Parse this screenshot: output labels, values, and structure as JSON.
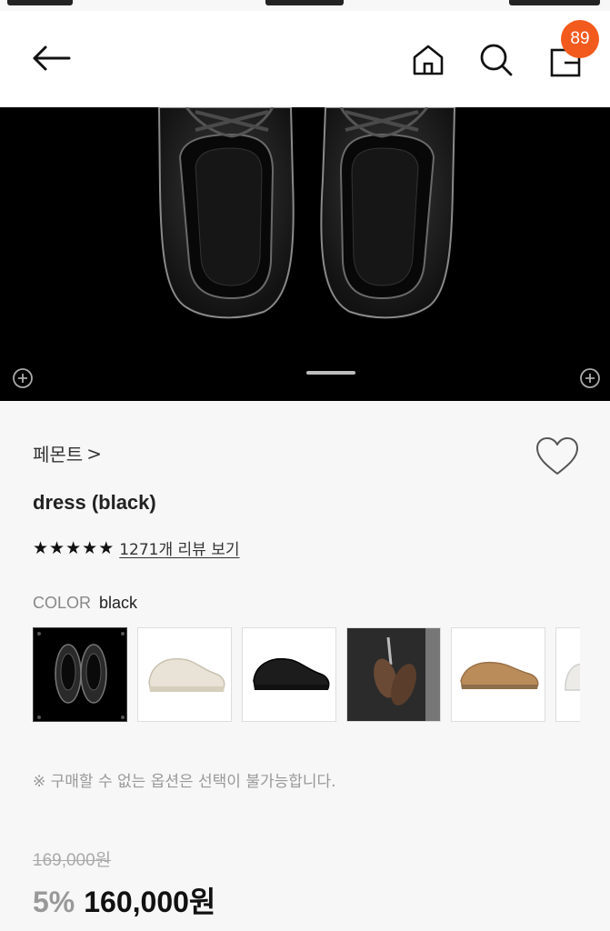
{
  "header": {
    "cart_count": "89"
  },
  "product": {
    "brand": "페몬트",
    "brand_chevron": ">",
    "name": "dress (black)",
    "rating_stars": 5,
    "review_link": "1271개 리뷰 보기",
    "color_label": "COLOR",
    "color_value": "black",
    "option_notice": "※ 구매할 수 없는 옵션은 선택이 불가능합니다.",
    "original_price": "169,000원",
    "discount": "5%",
    "sale_price": "160,000원"
  },
  "color_options": [
    {
      "name": "black",
      "selected": true
    },
    {
      "name": "cream",
      "selected": false
    },
    {
      "name": "black-side",
      "selected": false
    },
    {
      "name": "brown-suede",
      "selected": false
    },
    {
      "name": "tan",
      "selected": false
    },
    {
      "name": "white",
      "selected": false
    }
  ],
  "gallery": {
    "current_slide": 1
  },
  "colors": {
    "accent": "#f35a1e",
    "hero_background": "#000000",
    "page_background": "#f7f7f8"
  },
  "icons": [
    "back-arrow-icon",
    "home-icon",
    "search-icon",
    "shopping-bag-icon",
    "heart-icon",
    "star-icon",
    "gallery-zoom-icon"
  ]
}
